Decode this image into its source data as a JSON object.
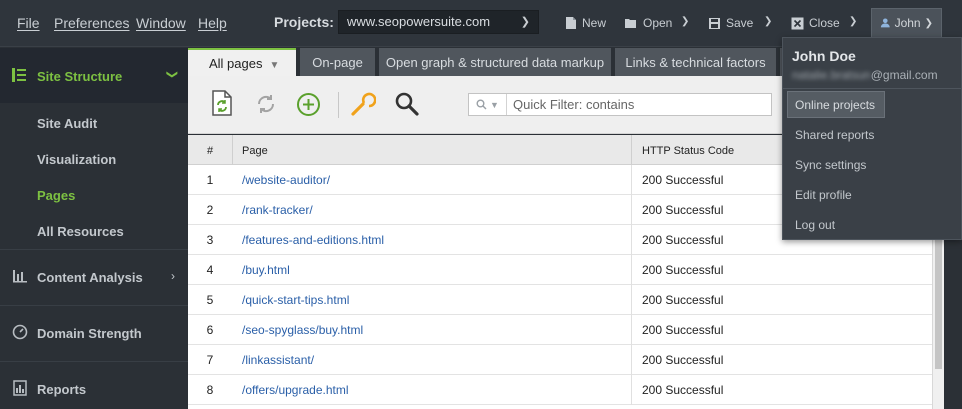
{
  "menu": {
    "file": "File",
    "preferences": "Preferences",
    "window": "Window",
    "help": "Help"
  },
  "projects": {
    "label": "Projects:",
    "selected": "www.seopowersuite.com"
  },
  "toolbar_top": {
    "new": "New",
    "open": "Open",
    "save": "Save",
    "close": "Close",
    "user": "John"
  },
  "sidebar": {
    "head": "Site Structure",
    "subitems": [
      "Site Audit",
      "Visualization",
      "Pages",
      "All Resources"
    ],
    "active": "Pages",
    "sections": [
      "Content Analysis",
      "Domain Strength",
      "Reports"
    ]
  },
  "tabs": [
    "All pages",
    "On-page",
    "Open graph & structured data markup",
    "Links & technical factors"
  ],
  "filter": {
    "placeholder": "Quick Filter: contains"
  },
  "table": {
    "columns": {
      "num": "#",
      "page": "Page",
      "status": "HTTP Status Code"
    },
    "rows": [
      {
        "num": "1",
        "page": "/website-auditor/",
        "status": "200 Successful"
      },
      {
        "num": "2",
        "page": "/rank-tracker/",
        "status": "200 Successful"
      },
      {
        "num": "3",
        "page": "/features-and-editions.html",
        "status": "200 Successful"
      },
      {
        "num": "4",
        "page": "/buy.html",
        "status": "200 Successful"
      },
      {
        "num": "5",
        "page": "/quick-start-tips.html",
        "status": "200 Successful"
      },
      {
        "num": "6",
        "page": "/seo-spyglass/buy.html",
        "status": "200 Successful"
      },
      {
        "num": "7",
        "page": "/linkassistant/",
        "status": "200 Successful"
      },
      {
        "num": "8",
        "page": "/offers/upgrade.html",
        "status": "200 Successful"
      }
    ]
  },
  "user_menu": {
    "name": "John Doe",
    "email_hidden": "natalie.bratsun",
    "email_domain": "@gmail.com",
    "items": [
      "Online projects",
      "Shared reports",
      "Sync settings",
      "Edit profile",
      "Log out"
    ]
  },
  "colors": {
    "accent": "#7dc142",
    "link": "#2a5fa8",
    "sidebar_bg": "#2b3036"
  }
}
